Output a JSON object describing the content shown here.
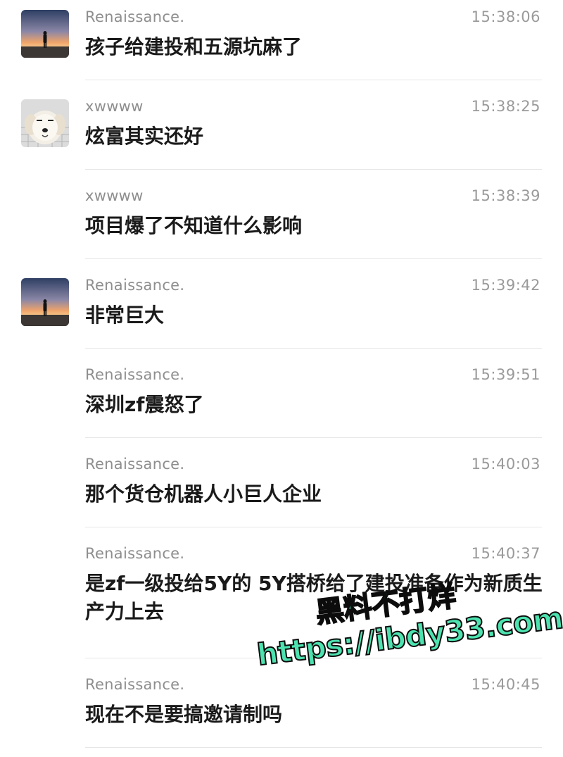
{
  "messages": [
    {
      "sender": "Renaissance.",
      "time": "15:38:06",
      "text": "孩子给建投和五源坑麻了",
      "avatar": "sunset-silhouette"
    },
    {
      "sender": "xwwww",
      "time": "15:38:25",
      "text": "炫富其实还好",
      "avatar": "puppy"
    },
    {
      "sender": "xwwww",
      "time": "15:38:39",
      "text": "项目爆了不知道什么影响",
      "avatar": null
    },
    {
      "sender": "Renaissance.",
      "time": "15:39:42",
      "text": "非常巨大",
      "avatar": "sunset-silhouette"
    },
    {
      "sender": "Renaissance.",
      "time": "15:39:51",
      "text": "深圳zf震怒了",
      "avatar": null
    },
    {
      "sender": "Renaissance.",
      "time": "15:40:03",
      "text": "那个货仓机器人小巨人企业",
      "avatar": null
    },
    {
      "sender": "Renaissance.",
      "time": "15:40:37",
      "text": "是zf一级投给5Y的 5Y搭桥给了建投准备作为新质生产力上去",
      "avatar": null
    },
    {
      "sender": "Renaissance.",
      "time": "15:40:45",
      "text": "现在不是要搞邀请制吗",
      "avatar": null
    }
  ],
  "watermark": {
    "line1": "黑料不打烊",
    "line2": "https://ibdy33.com",
    "color": "#4de3b0"
  }
}
